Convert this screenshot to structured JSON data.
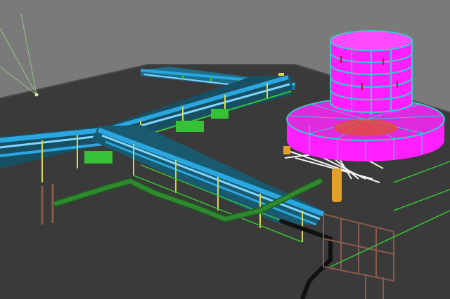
{
  "viewport": {
    "background": "#7a7a7a",
    "ground": "#3a3a3a",
    "ground_edge": "#555555"
  },
  "palette": {
    "pipe_main": "#2aa7e0",
    "pipe_highlight": "#7fd6ff",
    "pipe_green": "#2f8a2f",
    "pipe_green_dark": "#1d5c1d",
    "steel_yellow": "#d8d84a",
    "steel_green": "#36c236",
    "steel_brown": "#8a5a4a",
    "tank_magenta": "#ff1fff",
    "tank_magenta_shade": "#c000c8",
    "tank_frame": "#3cc7c7",
    "platform_white": "#f2f2f2",
    "vessel_orange": "#e0a02a",
    "duct_black": "#111111"
  },
  "scene_objects": [
    "ground-slab",
    "pipe-rack-main",
    "pipe-rack-branch",
    "green-pipeline",
    "cylindrical-tank",
    "tank-skirt-platform",
    "white-support-grid",
    "brown-steel-frame",
    "survey-lines"
  ]
}
